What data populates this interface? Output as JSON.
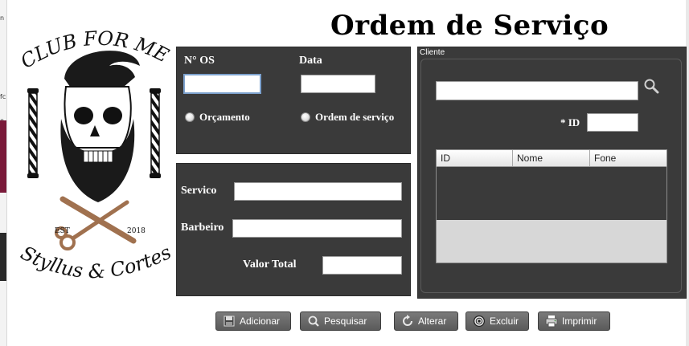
{
  "title": "Ordem de Serviço",
  "logo": {
    "top_text": "CLUB FOR MEN",
    "est_left": "EST",
    "est_right": "2018",
    "bottom_text": "Styllus & Cortes"
  },
  "os_panel": {
    "os_label": "N° OS",
    "os_value": "",
    "data_label": "Data",
    "data_value": "",
    "radio_orcamento": "Orçamento",
    "radio_ordem": "Ordem de serviço"
  },
  "servico_panel": {
    "servico_label": "Servico",
    "servico_value": "",
    "barbeiro_label": "Barbeiro",
    "barbeiro_value": "",
    "valor_label": "Valor Total",
    "valor_value": ""
  },
  "cliente": {
    "legend": "Cliente",
    "search_value": "",
    "id_label": "* ID",
    "id_value": "",
    "columns": [
      "ID",
      "Nome",
      "Fone"
    ]
  },
  "buttons": {
    "adicionar": "Adicionar",
    "pesquisar": "Pesquisar",
    "alterar": "Alterar",
    "excluir": "Excluir",
    "imprimir": "Imprimir"
  },
  "icons": {
    "adicionar": "floppy-disk-icon",
    "pesquisar": "magnifier-icon",
    "alterar": "refresh-icon",
    "excluir": "target-icon",
    "imprimir": "printer-icon",
    "search": "search-icon"
  },
  "colors": {
    "panel": "#3a3a3a",
    "button": "#6a6a6a",
    "logo_scissors": "#a0714f"
  }
}
